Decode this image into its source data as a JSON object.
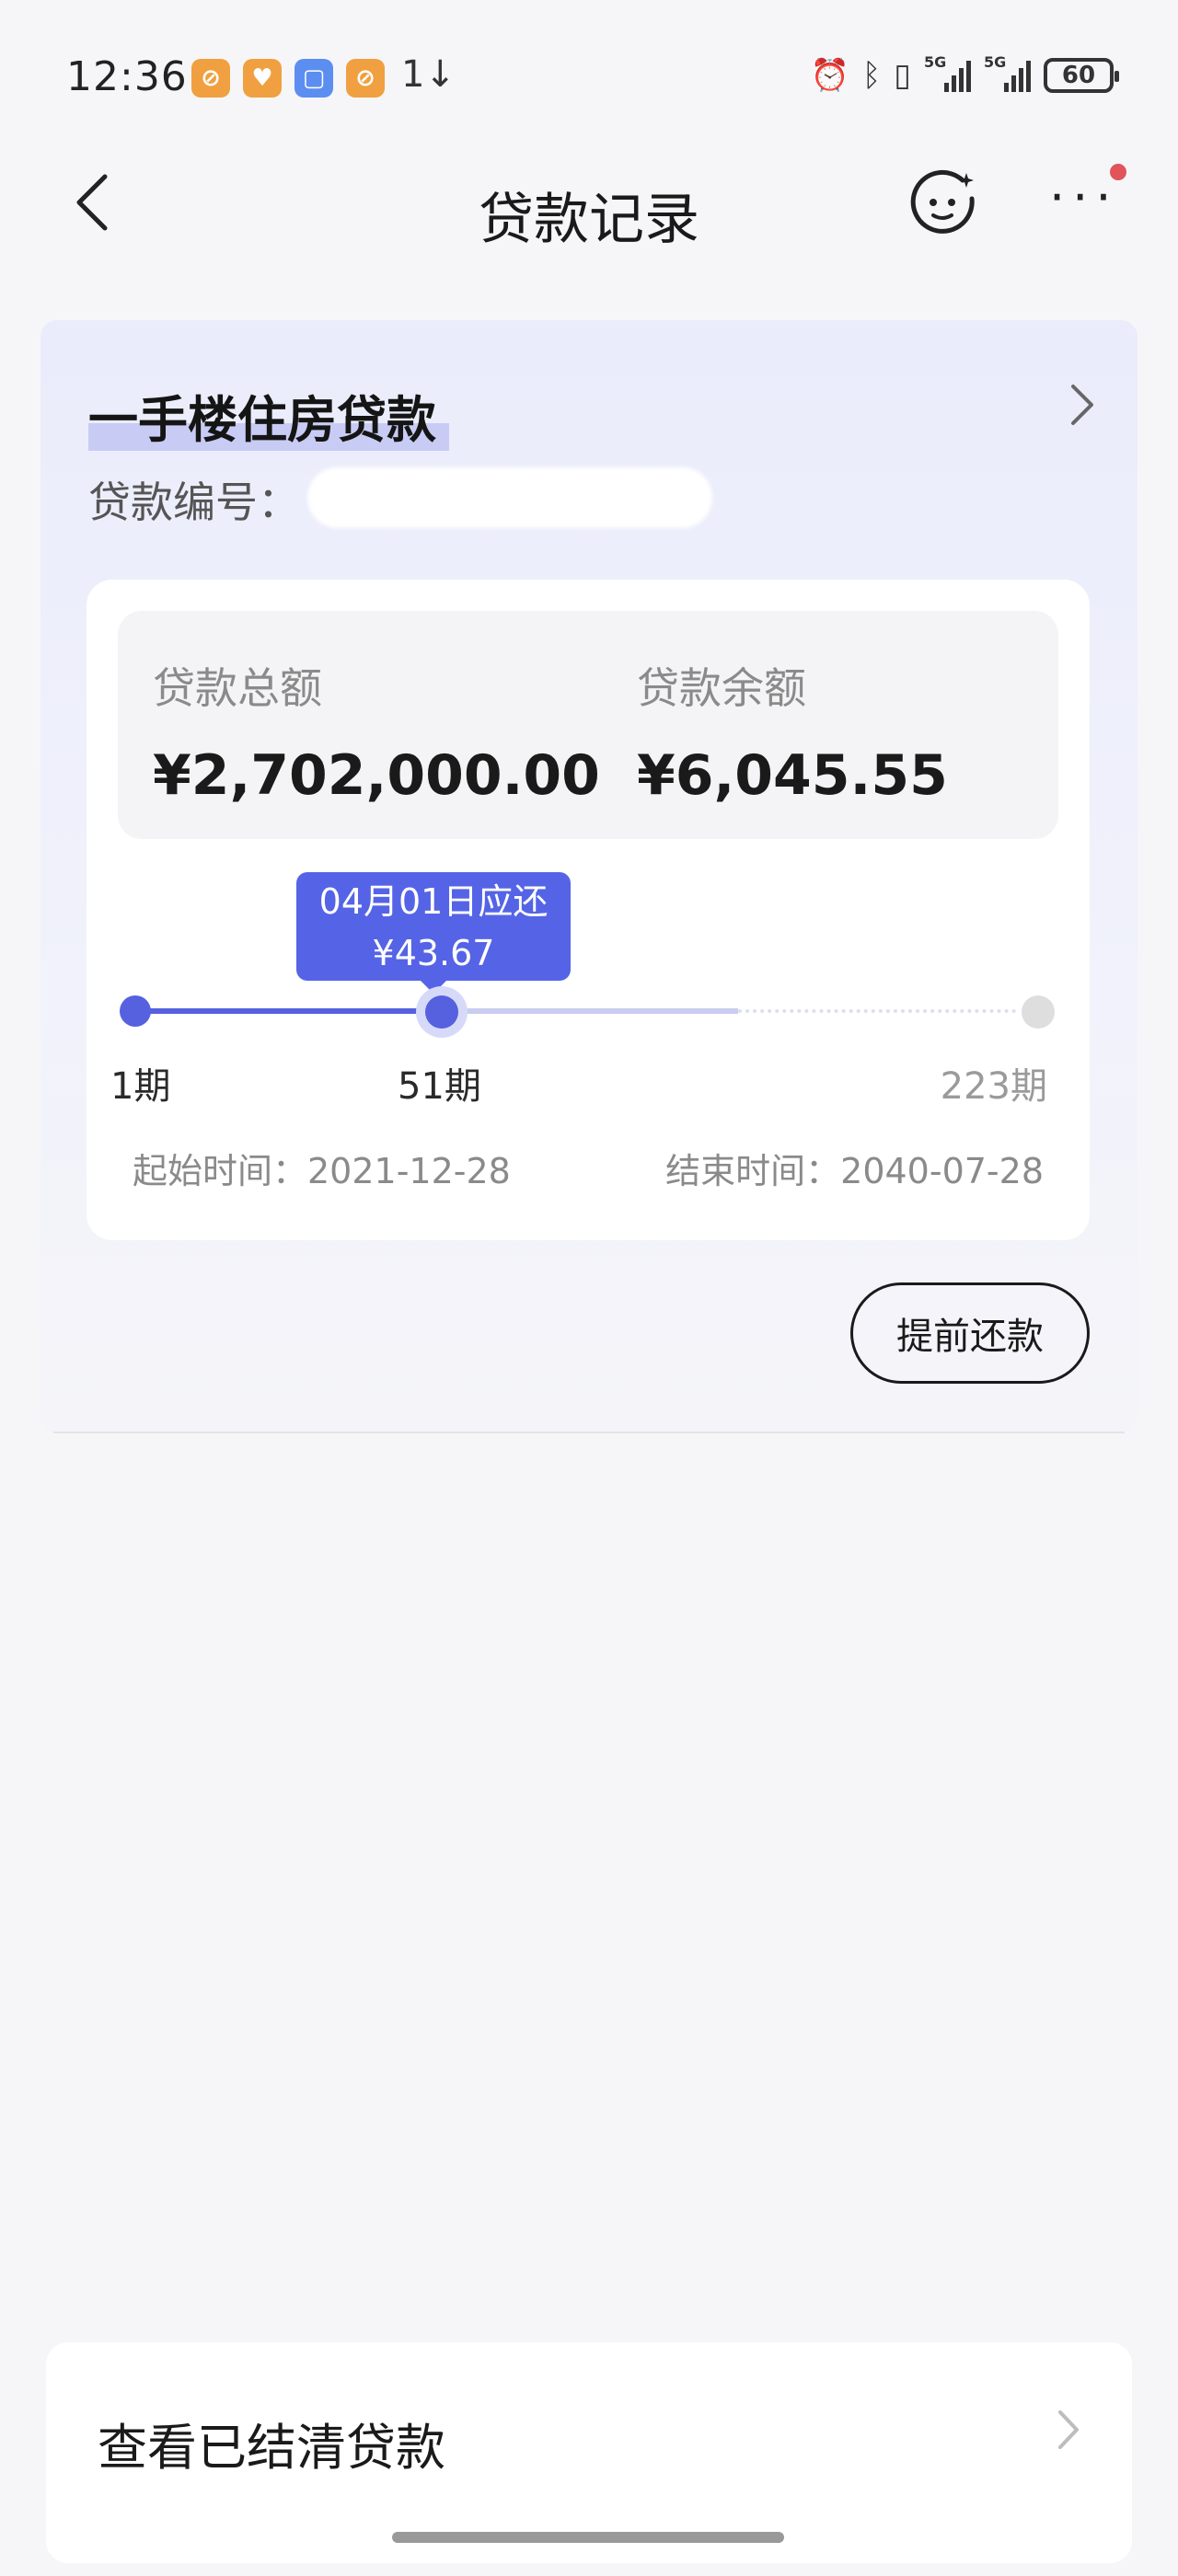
{
  "status_bar": {
    "time": "12:36",
    "sync_glyph": "1↓",
    "battery": "60",
    "signal_tag": "5G",
    "app_icons": [
      "orange-app-icon",
      "orange-heart-app-icon",
      "blue-app-icon",
      "orange-app-icon"
    ]
  },
  "nav": {
    "title": "贷款记录",
    "back_icon": "chevron-left-icon",
    "assistant_icon": "assistant-face-icon",
    "more_icon": "more-dots-icon"
  },
  "loan": {
    "type": "一手楼住房贷款",
    "number_label": "贷款编号：",
    "total_label": "贷款总额",
    "total_value": "¥2,702,000.00",
    "balance_label": "贷款余额",
    "balance_value": "¥6,045.55",
    "tooltip_line1": "04月01日应还",
    "tooltip_line2": "¥43.67",
    "progress": {
      "start": "1期",
      "current": "51期",
      "end": "223期",
      "current_period": 51,
      "total_periods": 223
    },
    "start_date": "起始时间：2021-12-28",
    "end_date": "结束时间：2040-07-28",
    "prepay_button": "提前还款"
  },
  "settled_link": "查看已结清贷款",
  "colors": {
    "accent": "#5561df",
    "tooltip": "#5564e6",
    "card_top": "#eaecfb",
    "background": "#f6f6f8",
    "notification": "#e0545a"
  }
}
